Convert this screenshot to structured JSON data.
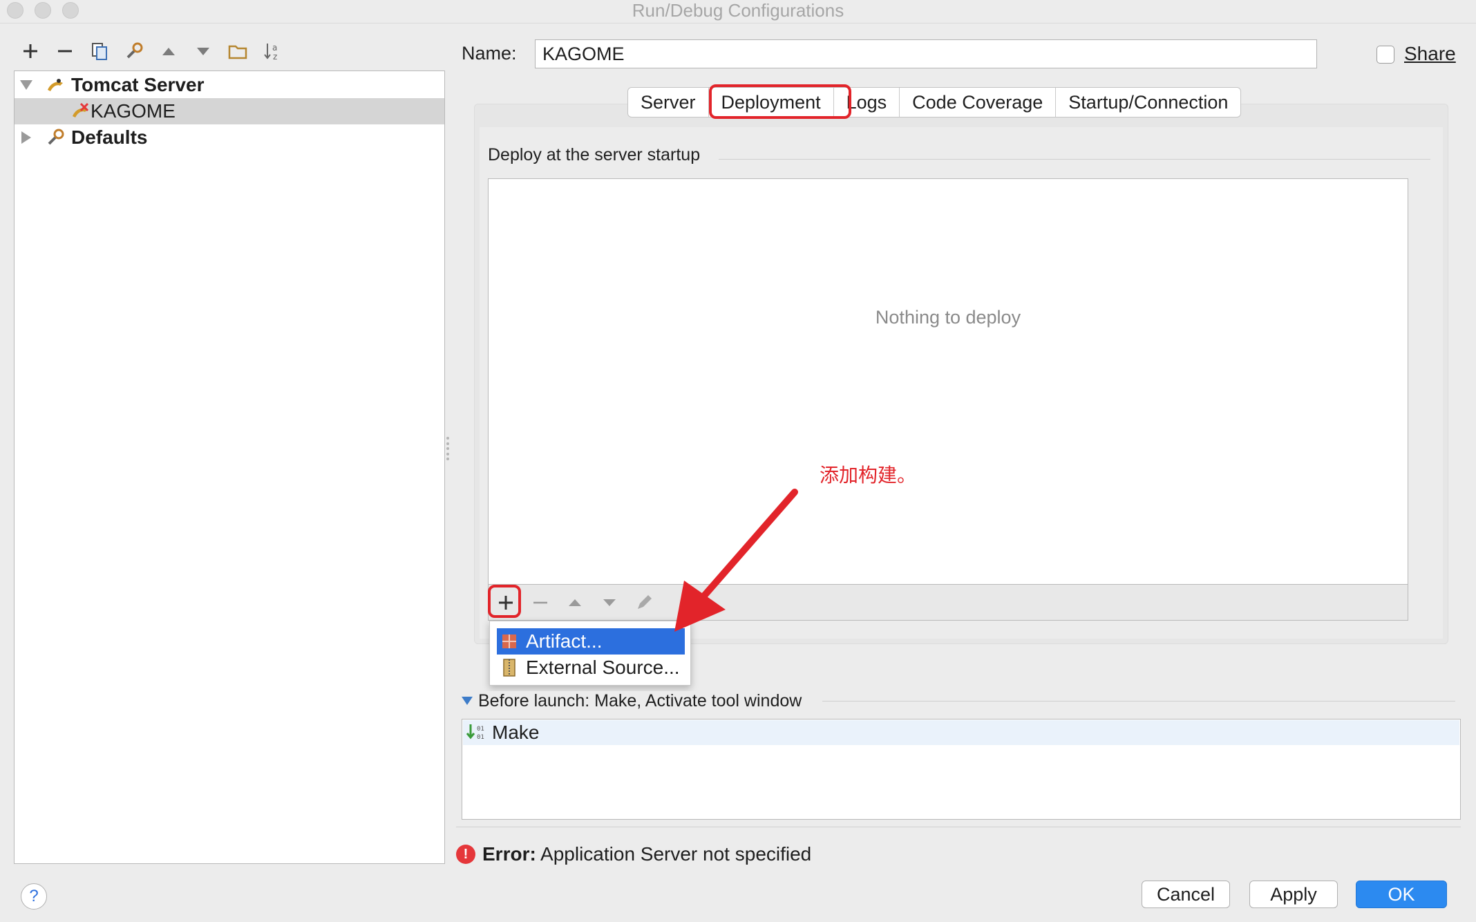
{
  "window": {
    "title": "Run/Debug Configurations"
  },
  "tree": {
    "items": [
      {
        "label": "Tomcat Server",
        "expanded": true
      },
      {
        "label": "KAGOME",
        "selected": true
      },
      {
        "label": "Defaults",
        "expanded": false
      }
    ]
  },
  "config": {
    "name_label": "Name:",
    "name_value": "KAGOME",
    "share_label": "Share"
  },
  "tabs": [
    {
      "label": "Server"
    },
    {
      "label": "Deployment",
      "active": true
    },
    {
      "label": "Logs"
    },
    {
      "label": "Code Coverage"
    },
    {
      "label": "Startup/Connection"
    }
  ],
  "deploy": {
    "group_title": "Deploy at the server startup",
    "empty_text": "Nothing to deploy"
  },
  "popup": {
    "items": [
      {
        "label": "Artifact...",
        "selected": true
      },
      {
        "label": "External Source..."
      }
    ]
  },
  "annotation": {
    "text": "添加构建。",
    "color": "#e2242a"
  },
  "before_launch": {
    "title": "Before launch: Make, Activate tool window",
    "items": [
      {
        "label": "Make"
      }
    ]
  },
  "error": {
    "prefix": "Error:",
    "message": "Application Server not specified"
  },
  "buttons": {
    "cancel": "Cancel",
    "apply": "Apply",
    "ok": "OK",
    "help": "?"
  },
  "colors": {
    "accent": "#2c6fde",
    "highlight": "#e2242a",
    "primary_button": "#2c8af0"
  }
}
